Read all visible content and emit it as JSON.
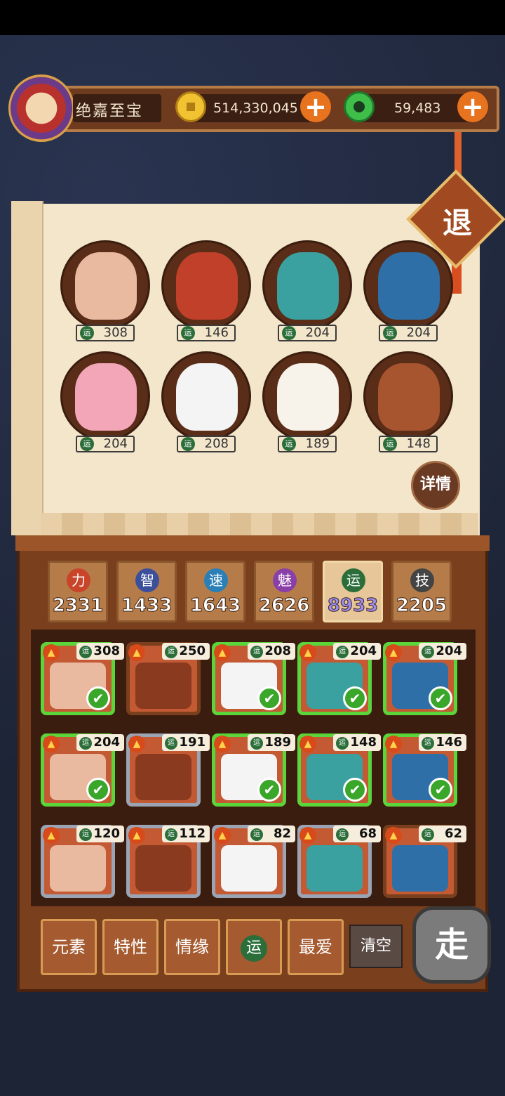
{
  "header": {
    "player_name": "绝嘉至宝",
    "coins": "514,330,045",
    "jade": "59,483",
    "plus": "+"
  },
  "quit_label": "退",
  "detail_label": "详情",
  "scroll_heroes": [
    {
      "value": "308",
      "color": "#e9b9a0"
    },
    {
      "value": "146",
      "color": "#c0402a"
    },
    {
      "value": "204",
      "color": "#3aa0a0"
    },
    {
      "value": "204",
      "color": "#2e6fa8"
    },
    {
      "value": "204",
      "color": "#f2a6b8"
    },
    {
      "value": "208",
      "color": "#f4f4f4"
    },
    {
      "value": "189",
      "color": "#f8f3ea"
    },
    {
      "value": "148",
      "color": "#a7552f"
    }
  ],
  "yun": "运",
  "stats": [
    {
      "icon": "力",
      "value": "2331",
      "color": "#c8452a"
    },
    {
      "icon": "智",
      "value": "1433",
      "color": "#3b4f9a"
    },
    {
      "icon": "速",
      "value": "1643",
      "color": "#2a7fb6"
    },
    {
      "icon": "魅",
      "value": "2626",
      "color": "#8a3fa8"
    },
    {
      "icon": "运",
      "value": "8933",
      "color": "#2b6e3a"
    },
    {
      "icon": "技",
      "value": "2205",
      "color": "#444444"
    }
  ],
  "cards": [
    {
      "value": "308",
      "state": "on"
    },
    {
      "value": "250",
      "state": "plain"
    },
    {
      "value": "208",
      "state": "on"
    },
    {
      "value": "204",
      "state": "on"
    },
    {
      "value": "204",
      "state": "on"
    },
    {
      "value": "204",
      "state": "on"
    },
    {
      "value": "191",
      "state": "off"
    },
    {
      "value": "189",
      "state": "on"
    },
    {
      "value": "148",
      "state": "on"
    },
    {
      "value": "146",
      "state": "on"
    },
    {
      "value": "120",
      "state": "off"
    },
    {
      "value": "112",
      "state": "off"
    },
    {
      "value": "82",
      "state": "off"
    },
    {
      "value": "68",
      "state": "off"
    },
    {
      "value": "62",
      "state": "plain"
    }
  ],
  "filters": [
    "元素",
    "特性",
    "情缘",
    "运",
    "最爱"
  ],
  "clear_label": "清空",
  "go_label": "走",
  "check_mark": "✔",
  "fire_mark": "▲"
}
